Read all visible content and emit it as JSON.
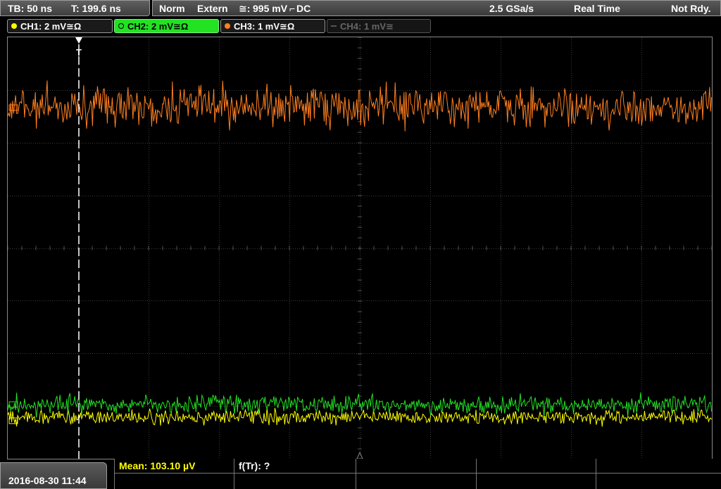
{
  "timebase": {
    "tb": "TB: 50 ns",
    "trigger_time": "T: 199.6 ns"
  },
  "trigger": {
    "mode": "Norm",
    "source": "Extern",
    "coupling_symbol": "≅:",
    "level": "995 mV",
    "slope_symbol": "⌐",
    "coupling": "DC",
    "sample_rate": "2.5 GSa/s",
    "acq_mode": "Real Time",
    "status": "Not Rdy."
  },
  "channels": [
    {
      "label": "CH1: 2 mV≅Ω",
      "color": "#ffff00",
      "state": "on"
    },
    {
      "label": "CH2: 2 mV≅Ω",
      "color": "#22e222",
      "state": "active"
    },
    {
      "label": "CH3: 1 mV≅Ω",
      "color": "#ff7f1f",
      "state": "on"
    },
    {
      "label": "CH4: 1 mV≅",
      "color": "#555555",
      "state": "off"
    }
  ],
  "trigger_marker": "T",
  "datetime": "2016-08-30 11:44",
  "measurements": {
    "mean": "Mean: 103.10 µV",
    "ftr": "f(Tr): ?"
  },
  "colors": {
    "ch1": "#ffff00",
    "ch2": "#22e222",
    "ch3": "#ff7f1f",
    "grid": "#3a3a3a",
    "trigger_line": "#ffffff"
  }
}
